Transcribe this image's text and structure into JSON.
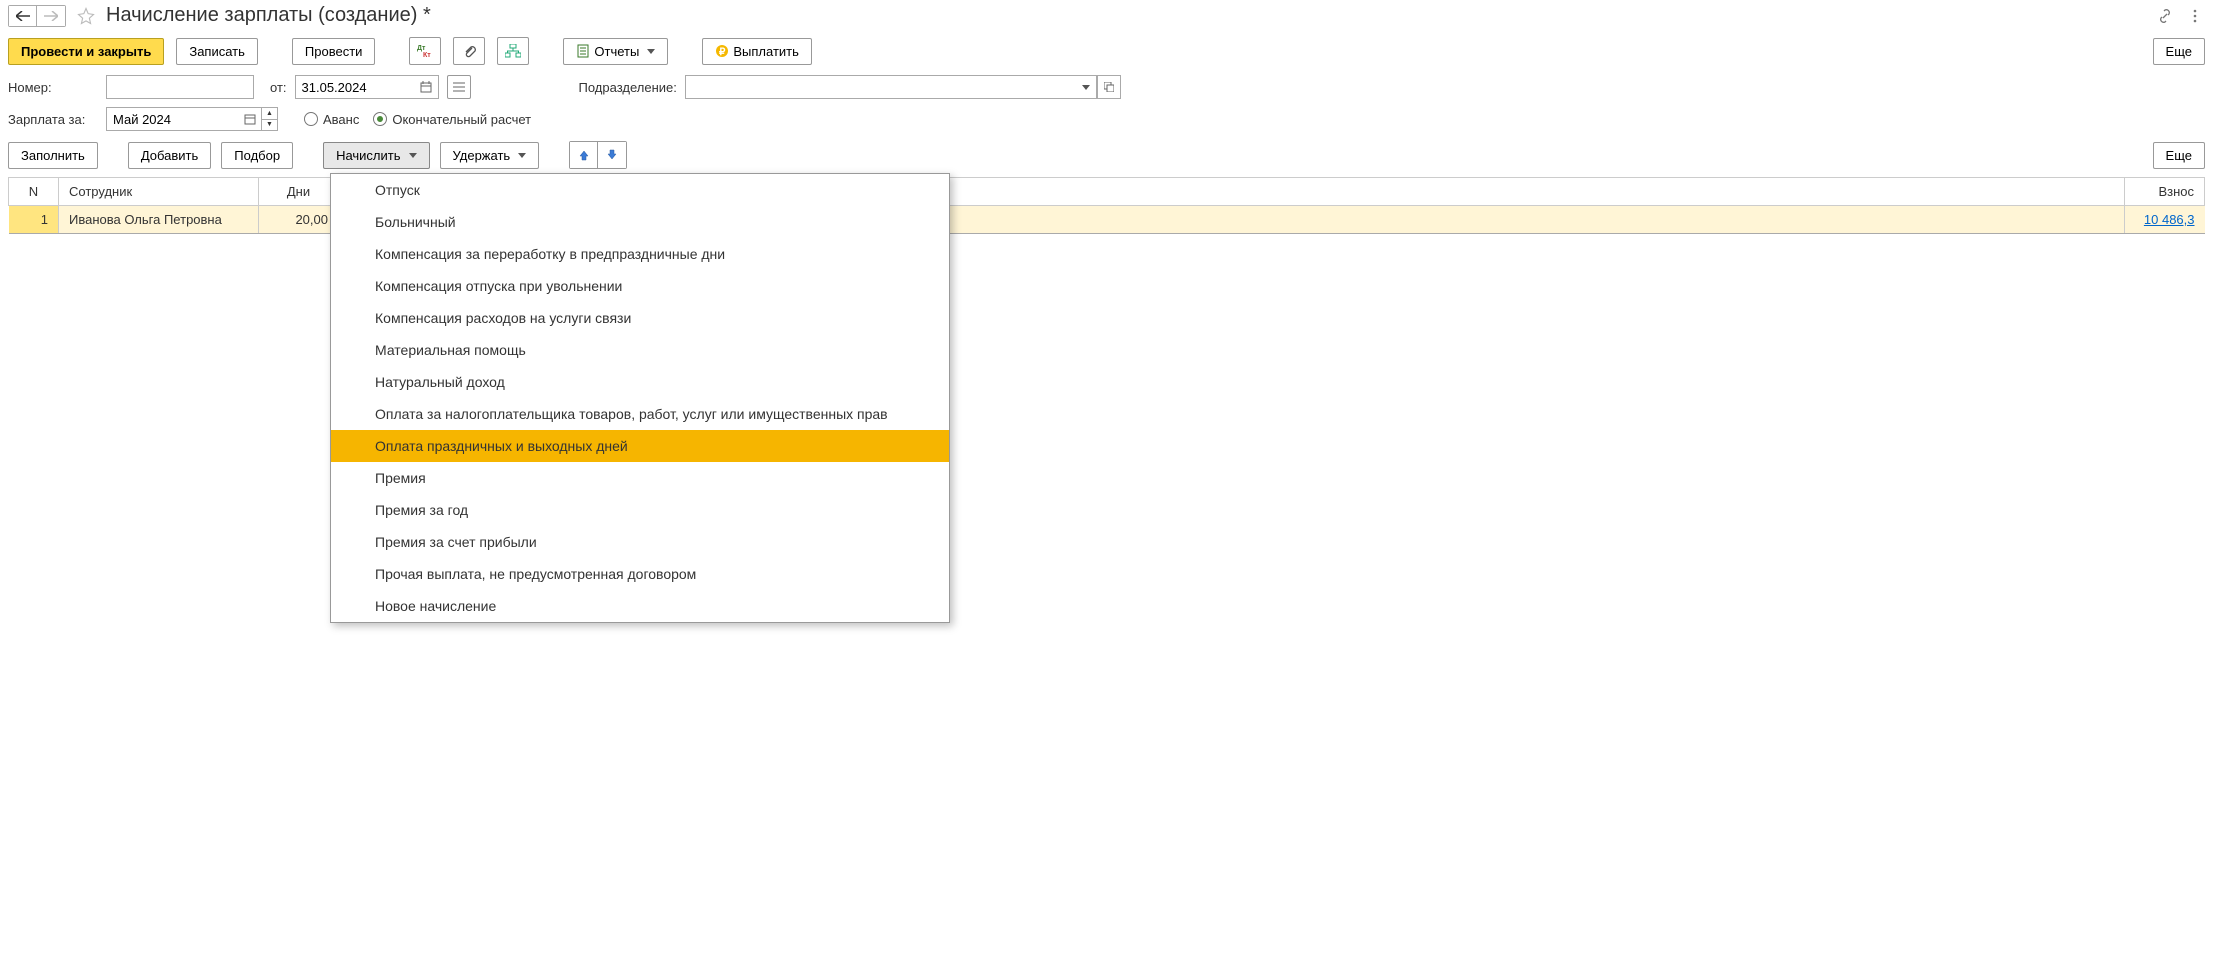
{
  "title": "Начисление зарплаты (создание) *",
  "toolbar": {
    "post_close": "Провести и закрыть",
    "save": "Записать",
    "post": "Провести",
    "reports": "Отчеты",
    "pay": "Выплатить",
    "more": "Еще"
  },
  "form": {
    "number_label": "Номер:",
    "number_value": "",
    "from_label": "от:",
    "date_value": "31.05.2024",
    "department_label": "Подразделение:",
    "department_value": "",
    "salary_for_label": "Зарплата за:",
    "period_value": "Май 2024",
    "advance_label": "Аванс",
    "final_label": "Окончательный расчет"
  },
  "toolbar2": {
    "fill": "Заполнить",
    "add": "Добавить",
    "pick": "Подбор",
    "accrue": "Начислить",
    "withhold": "Удержать",
    "more": "Еще"
  },
  "table": {
    "headers": {
      "n": "N",
      "employee": "Сотрудник",
      "days": "Дни",
      "contrib": "Взнос"
    },
    "rows": [
      {
        "n": "1",
        "employee": "Иванова Ольга Петровна",
        "days": "20,00",
        "contrib": "10 486,3"
      }
    ]
  },
  "dropdown": {
    "items": [
      "Отпуск",
      "Больничный",
      "Компенсация за переработку в предпраздничные дни",
      "Компенсация отпуска при увольнении",
      "Компенсация расходов на услуги связи",
      "Материальная помощь",
      "Натуральный доход",
      "Оплата за налогоплательщика товаров, работ, услуг или имущественных прав",
      "Оплата праздничных и выходных дней",
      "Премия",
      "Премия за год",
      "Премия за счет прибыли",
      "Прочая выплата, не предусмотренная договором",
      "Новое начисление"
    ],
    "highlighted_index": 8
  }
}
